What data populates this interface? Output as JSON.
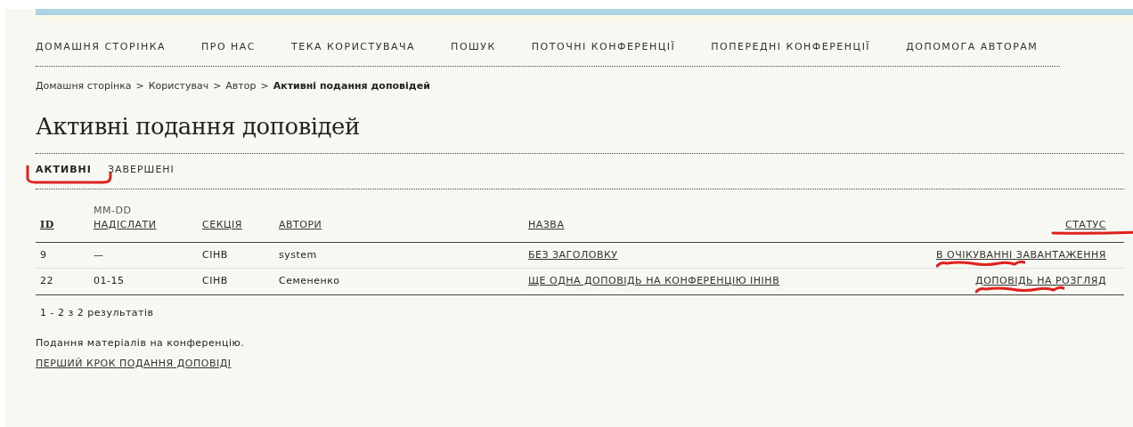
{
  "nav": [
    {
      "label": "ДОМАШНЯ СТОРІНКА"
    },
    {
      "label": "ПРО НАС"
    },
    {
      "label": "ТЕКА КОРИСТУВАЧА"
    },
    {
      "label": "ПОШУК"
    },
    {
      "label": "ПОТОЧНІ КОНФЕРЕНЦІЇ"
    },
    {
      "label": "ПОПЕРЕДНІ КОНФЕРЕНЦІЇ"
    },
    {
      "label": "ДОПОМОГА АВТОРАМ"
    }
  ],
  "breadcrumb": [
    {
      "label": "Домашня сторінка",
      "current": false
    },
    {
      "label": "Користувач",
      "current": false
    },
    {
      "label": "Автор",
      "current": false
    },
    {
      "label": "Активні подання доповідей",
      "current": true
    }
  ],
  "breadcrumb_separator": ">",
  "title": "Активні подання доповідей",
  "tabs": [
    {
      "label": "АКТИВНІ",
      "selected": true,
      "highlighted": true
    },
    {
      "label": "ЗАВЕРШЕНІ",
      "selected": false,
      "highlighted": false
    }
  ],
  "table": {
    "columns": [
      {
        "label": "ID",
        "sorted": true,
        "highlighted": false
      },
      {
        "label": "НАДІСЛАТИ",
        "caption": "MM-DD",
        "sorted": false,
        "highlighted": false
      },
      {
        "label": "СЕКЦІЯ",
        "sorted": false,
        "highlighted": false
      },
      {
        "label": "АВТОРИ",
        "sorted": false,
        "highlighted": false
      },
      {
        "label": "НАЗВА",
        "sorted": false,
        "highlighted": false
      },
      {
        "label": "СТАТУС",
        "sorted": false,
        "highlighted": true
      }
    ],
    "rows": [
      {
        "id": "9",
        "submitted": "—",
        "section": "СІНВ",
        "authors": "system",
        "title": "БЕЗ ЗАГОЛОВКУ",
        "status": "В ОЧІКУВАННІ ЗАВАНТАЖЕННЯ",
        "status_highlighted": true
      },
      {
        "id": "22",
        "submitted": "01-15",
        "section": "СІНВ",
        "authors": "Семененко",
        "title": "ЩЕ ОДНА ДОПОВІДЬ НА КОНФЕРЕНЦІЮ ІНІНВ",
        "status": "ДОПОВІДЬ НА РОЗГЛЯД",
        "status_highlighted": true
      }
    ],
    "results": "1 - 2 з 2 результатів"
  },
  "footer": {
    "text": "Подання матеріалів на конференцію.",
    "link": "ПЕРШИЙ КРОК ПОДАННЯ ДОПОВІДІ"
  }
}
